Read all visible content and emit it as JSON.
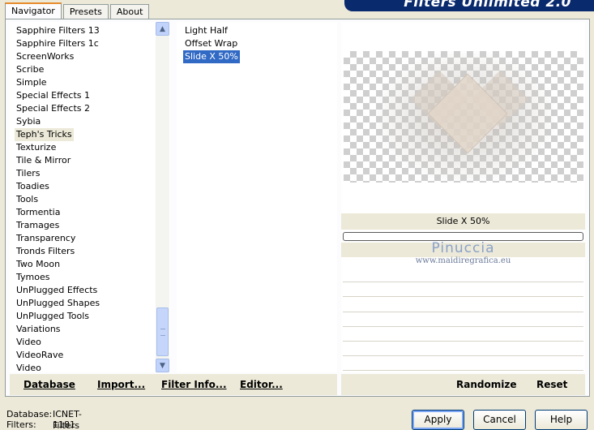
{
  "header": {
    "title": "Filters Unlimited 2.0"
  },
  "tabs": [
    {
      "label": "Navigator"
    },
    {
      "label": "Presets"
    },
    {
      "label": "About"
    }
  ],
  "categories": {
    "items": [
      "Sapphire Filters 13",
      "Sapphire Filters 1c",
      "ScreenWorks",
      "Scribe",
      "Simple",
      "Special Effects 1",
      "Special Effects 2",
      "Sybia",
      "Teph's Tricks",
      "Texturize",
      "Tile & Mirror",
      "Tilers",
      "Toadies",
      "Tools",
      "Tormentia",
      "Tramages",
      "Transparency",
      "Tronds Filters",
      "Two Moon",
      "Tymoes",
      "UnPlugged Effects",
      "UnPlugged Shapes",
      "UnPlugged Tools",
      "Variations",
      "Video",
      "VideoRave",
      "Video"
    ],
    "selected": "Teph's Tricks"
  },
  "filters": {
    "items": [
      "Light Half",
      "Offset Wrap",
      "Slide X 50%"
    ],
    "selected": "Slide X 50%"
  },
  "preview": {
    "filter_name": "Slide X 50%",
    "progress": 0,
    "watermark_line1": "Pinuccia",
    "watermark_line2": "www.maidiregrafica.eu"
  },
  "toolbar": {
    "database": "Database",
    "import": "Import...",
    "filter_info": "Filter Info...",
    "editor": "Editor...",
    "randomize": "Randomize",
    "reset": "Reset"
  },
  "status": {
    "database_label": "Database:",
    "database_value": "ICNET-Filters",
    "filters_label": "Filters:",
    "filters_value": "1181"
  },
  "dialog": {
    "apply": "Apply",
    "cancel": "Cancel",
    "help": "Help"
  },
  "colors": {
    "selection": "#316ac5",
    "banner": "#0a2a6e",
    "tab_highlight": "#e68b2c"
  }
}
